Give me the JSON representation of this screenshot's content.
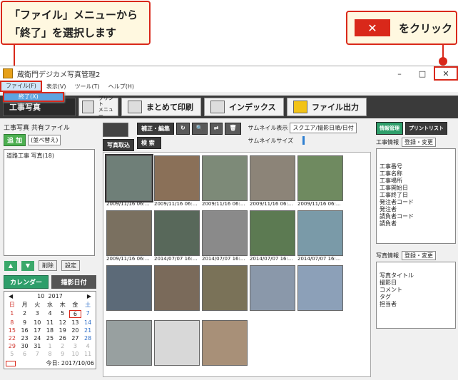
{
  "callouts": {
    "left_line1": "「ファイル」メニューから",
    "left_line2": "「終了」を選択します",
    "right_symbol": "✕",
    "right_text": "をクリック"
  },
  "window": {
    "title": "蔵衛門デジカメ写真管理2",
    "min": "–",
    "max": "□",
    "close": "✕"
  },
  "menu": {
    "items": [
      "ファイル(F)",
      "表示(V)",
      "ツール(T)",
      "ヘルプ(H)"
    ],
    "dropdown_item": "終了(X)"
  },
  "toolbar": {
    "home": "工事写真",
    "print_label": "プリント",
    "print_sub": "メニュー",
    "batch_print": "まとめて印刷",
    "index": "インデックス",
    "file_output": "ファイル出力"
  },
  "left": {
    "title": "工事写真 共有ファイル",
    "add": "追 加",
    "sort": "(並べ替え)",
    "tree_item": "道路工事 写真(18)",
    "delete": "削除",
    "settings": "設定",
    "calendar_btn": "カレンダー",
    "shot_date_btn": "撮影日付",
    "cal_month": "10",
    "cal_year": "2017",
    "weekdays": [
      "日",
      "月",
      "火",
      "水",
      "木",
      "金",
      "土"
    ],
    "days": [
      [
        "1",
        "2",
        "3",
        "4",
        "5",
        "6",
        "7"
      ],
      [
        "8",
        "9",
        "10",
        "11",
        "12",
        "13",
        "14"
      ],
      [
        "15",
        "16",
        "17",
        "18",
        "19",
        "20",
        "21"
      ],
      [
        "22",
        "23",
        "24",
        "25",
        "26",
        "27",
        "28"
      ],
      [
        "29",
        "30",
        "31",
        "1",
        "2",
        "3",
        "4"
      ],
      [
        "5",
        "6",
        "7",
        "8",
        "9",
        "10",
        "11"
      ]
    ],
    "today_label": "今日: 2017/10/06"
  },
  "center": {
    "capture": "写真取込",
    "edit": "補正・編集",
    "search": "検 索",
    "thumb_display_label": "サムネイル表示",
    "thumb_display_value": "スクエア/撮影日順/日付",
    "thumb_size_label": "サムネイルサイズ",
    "captions": [
      "2009/11/16 06:...",
      "2009/11/16 06:...",
      "2009/11/16 06:...",
      "2009/11/16 06:...",
      "2009/11/16 06:...",
      "2009/11/16 06:...",
      "2014/07/07 16:...",
      "2014/07/07 16:...",
      "2014/07/07 16:...",
      "2014/07/07 16:..."
    ]
  },
  "right": {
    "info_mgmt": "情報管理",
    "print_list": "プリントリスト",
    "project_info": "工事情報",
    "edit_reg": "登録・変更",
    "project_fields": [
      "工事番号",
      "工事名称",
      "工事場所",
      "工事開始日",
      "工事終了日",
      "発注者コード",
      "発注者",
      "請負者コード",
      "請負者"
    ],
    "photo_info": "写真情報",
    "photo_fields": [
      "写真タイトル",
      "撮影日",
      "コメント",
      "タグ",
      "担当者"
    ]
  }
}
